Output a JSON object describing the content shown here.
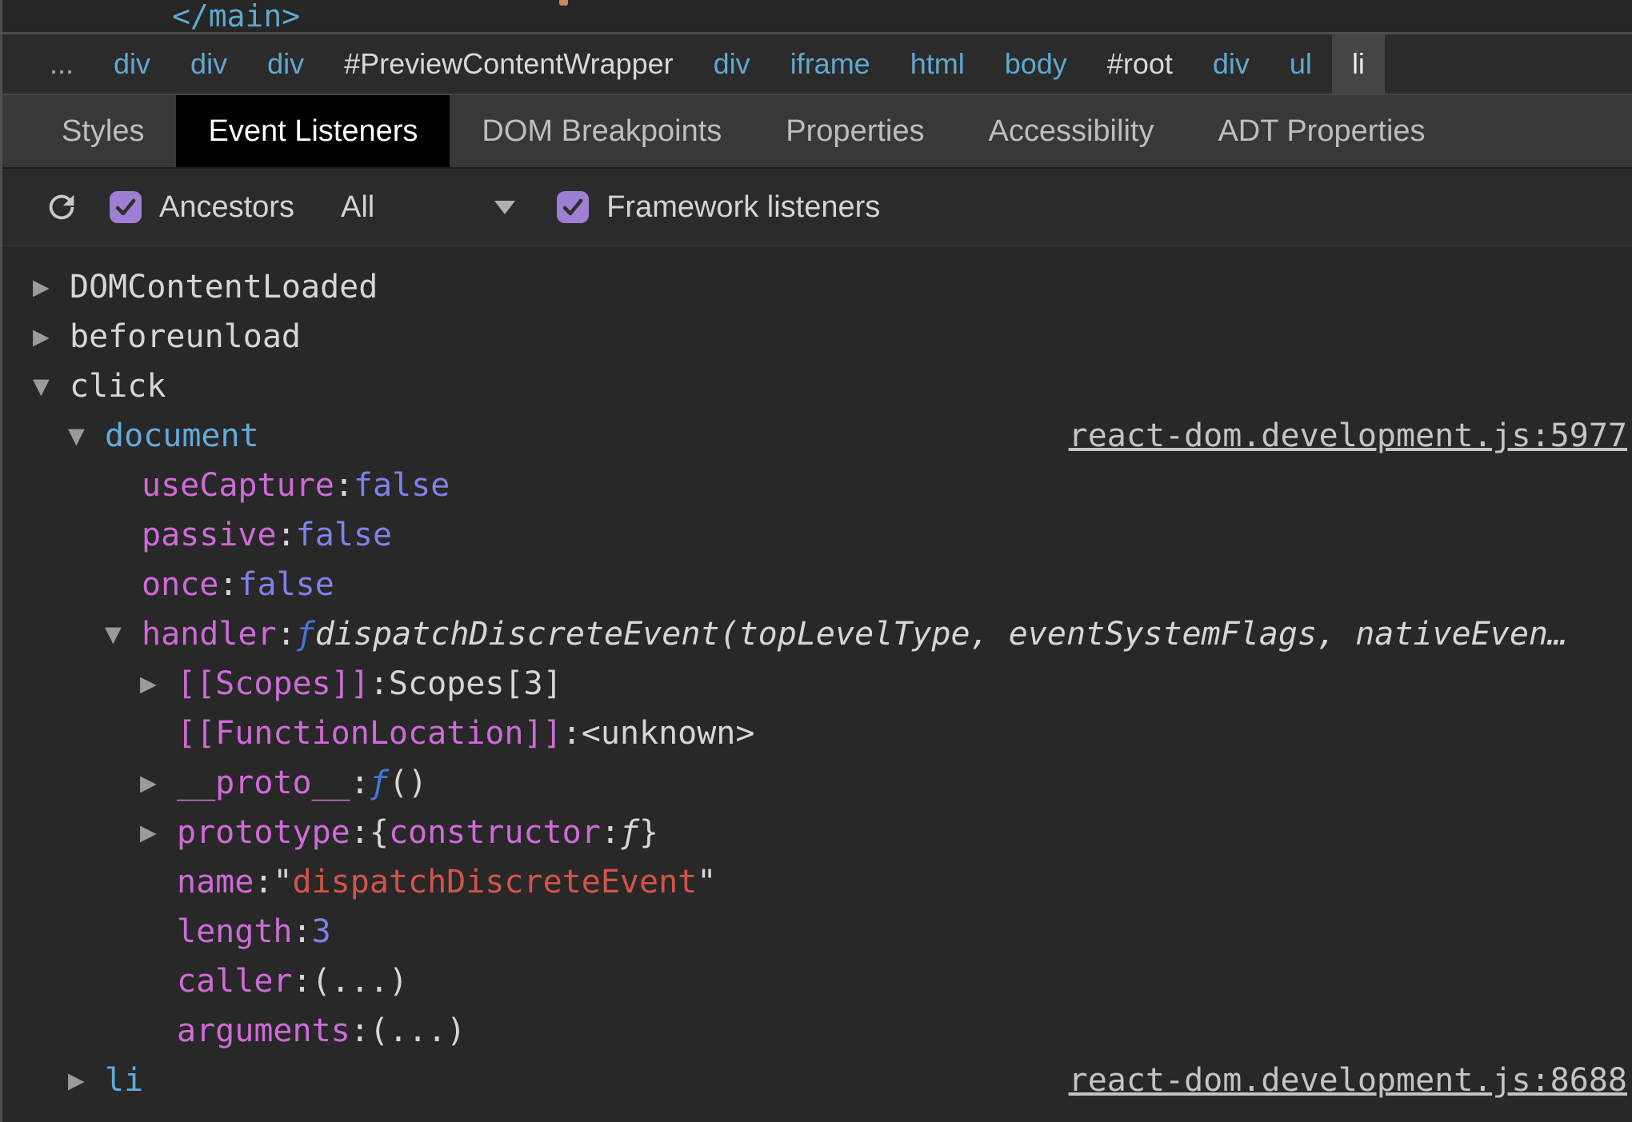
{
  "colors": {
    "checkbox_accent": "#9d7fd3",
    "tag_blue": "#5fa8d0",
    "key_magenta": "#cf6ad8",
    "value_purple": "#7e82e8",
    "string_red": "#d2544a",
    "function_blue": "#4676d8",
    "selected_tab_bg": "#000000"
  },
  "elements_panel": {
    "visible_code": "</main>"
  },
  "breadcrumbs": {
    "items": [
      {
        "label": "...",
        "type": "more",
        "selected": false
      },
      {
        "label": "div",
        "type": "tag",
        "selected": false
      },
      {
        "label": "div",
        "type": "tag",
        "selected": false
      },
      {
        "label": "div",
        "type": "tag",
        "selected": false
      },
      {
        "label": "#PreviewContentWrapper",
        "type": "id",
        "selected": false
      },
      {
        "label": "div",
        "type": "tag",
        "selected": false
      },
      {
        "label": "iframe",
        "type": "tag",
        "selected": false
      },
      {
        "label": "html",
        "type": "tag",
        "selected": false
      },
      {
        "label": "body",
        "type": "tag",
        "selected": false
      },
      {
        "label": "#root",
        "type": "id",
        "selected": false
      },
      {
        "label": "div",
        "type": "tag",
        "selected": false
      },
      {
        "label": "ul",
        "type": "tag",
        "selected": false
      },
      {
        "label": "li",
        "type": "tag",
        "selected": true
      }
    ]
  },
  "tabs": [
    {
      "label": "Styles",
      "selected": false
    },
    {
      "label": "Event Listeners",
      "selected": true
    },
    {
      "label": "DOM Breakpoints",
      "selected": false
    },
    {
      "label": "Properties",
      "selected": false
    },
    {
      "label": "Accessibility",
      "selected": false
    },
    {
      "label": "ADT Properties",
      "selected": false
    }
  ],
  "toolbar": {
    "refresh_icon": "refresh-icon",
    "ancestors": {
      "label": "Ancestors",
      "checked": true
    },
    "ancestors_filter": {
      "value": "All"
    },
    "framework": {
      "label": "Framework listeners",
      "checked": true
    }
  },
  "listeners": {
    "rows": [
      {
        "name": "event-domcontentloaded",
        "indent": 0,
        "arrow": "collapsed",
        "segments": [
          [
            "DOMContentLoaded",
            "plain"
          ]
        ]
      },
      {
        "name": "event-beforeunload",
        "indent": 0,
        "arrow": "collapsed",
        "segments": [
          [
            "beforeunload",
            "plain"
          ]
        ]
      },
      {
        "name": "event-click",
        "indent": 0,
        "arrow": "expanded",
        "segments": [
          [
            "click",
            "plain"
          ]
        ]
      },
      {
        "name": "listener-node-document",
        "indent": 1,
        "arrow": "expanded",
        "segments": [
          [
            "document",
            "node"
          ]
        ],
        "link": "react-dom.development.js:5977"
      },
      {
        "name": "prop-usecapture",
        "indent": 2,
        "arrow": null,
        "segments": [
          [
            "useCapture",
            "key"
          ],
          [
            ": ",
            "plain"
          ],
          [
            "false",
            "val"
          ]
        ]
      },
      {
        "name": "prop-passive",
        "indent": 2,
        "arrow": null,
        "segments": [
          [
            "passive",
            "key"
          ],
          [
            ": ",
            "plain"
          ],
          [
            "false",
            "val"
          ]
        ]
      },
      {
        "name": "prop-once",
        "indent": 2,
        "arrow": null,
        "segments": [
          [
            "once",
            "key"
          ],
          [
            ": ",
            "plain"
          ],
          [
            "false",
            "val"
          ]
        ]
      },
      {
        "name": "prop-handler",
        "indent": 2,
        "arrow": "expanded",
        "segments": [
          [
            "handler",
            "key"
          ],
          [
            ": ",
            "plain"
          ],
          [
            "ƒ ",
            "fn"
          ],
          [
            "dispatchDiscreteEvent(topLevelType, eventSystemFlags, nativeEven…",
            "sig"
          ]
        ]
      },
      {
        "name": "prop-scopes",
        "indent": 3,
        "arrow": "collapsed",
        "segments": [
          [
            "[[Scopes]]",
            "key"
          ],
          [
            ": ",
            "plain"
          ],
          [
            "Scopes[3]",
            "plain"
          ]
        ]
      },
      {
        "name": "prop-functionlocation",
        "indent": 3,
        "arrow": null,
        "segments": [
          [
            "[[FunctionLocation]]",
            "key"
          ],
          [
            ": ",
            "plain"
          ],
          [
            "<unknown>",
            "plain"
          ]
        ]
      },
      {
        "name": "prop-proto",
        "indent": 3,
        "arrow": "collapsed",
        "segments": [
          [
            "__proto__",
            "key"
          ],
          [
            ": ",
            "plain"
          ],
          [
            "ƒ ",
            "fn"
          ],
          [
            "()",
            "plain"
          ]
        ]
      },
      {
        "name": "prop-prototype",
        "indent": 3,
        "arrow": "collapsed",
        "segments": [
          [
            "prototype",
            "key"
          ],
          [
            ": ",
            "plain"
          ],
          [
            "{",
            "plain"
          ],
          [
            "constructor",
            "key"
          ],
          [
            ": ",
            "plain"
          ],
          [
            "ƒ",
            "fnlight"
          ],
          [
            "}",
            "plain"
          ]
        ]
      },
      {
        "name": "prop-name",
        "indent": 3,
        "arrow": null,
        "segments": [
          [
            "name",
            "key"
          ],
          [
            ": ",
            "plain"
          ],
          [
            "\"",
            "plain"
          ],
          [
            "dispatchDiscreteEvent",
            "str"
          ],
          [
            "\"",
            "plain"
          ]
        ]
      },
      {
        "name": "prop-length",
        "indent": 3,
        "arrow": null,
        "segments": [
          [
            "length",
            "key"
          ],
          [
            ": ",
            "plain"
          ],
          [
            "3",
            "val"
          ]
        ]
      },
      {
        "name": "prop-caller",
        "indent": 3,
        "arrow": null,
        "segments": [
          [
            "caller",
            "key"
          ],
          [
            ": ",
            "plain"
          ],
          [
            "(...)",
            "plain"
          ]
        ]
      },
      {
        "name": "prop-arguments",
        "indent": 3,
        "arrow": null,
        "segments": [
          [
            "arguments",
            "key"
          ],
          [
            ": ",
            "plain"
          ],
          [
            "(...)",
            "plain"
          ]
        ]
      },
      {
        "name": "listener-node-li",
        "indent": 1,
        "arrow": "collapsed",
        "segments": [
          [
            "li",
            "node"
          ]
        ],
        "link": "react-dom.development.js:8688"
      }
    ]
  }
}
